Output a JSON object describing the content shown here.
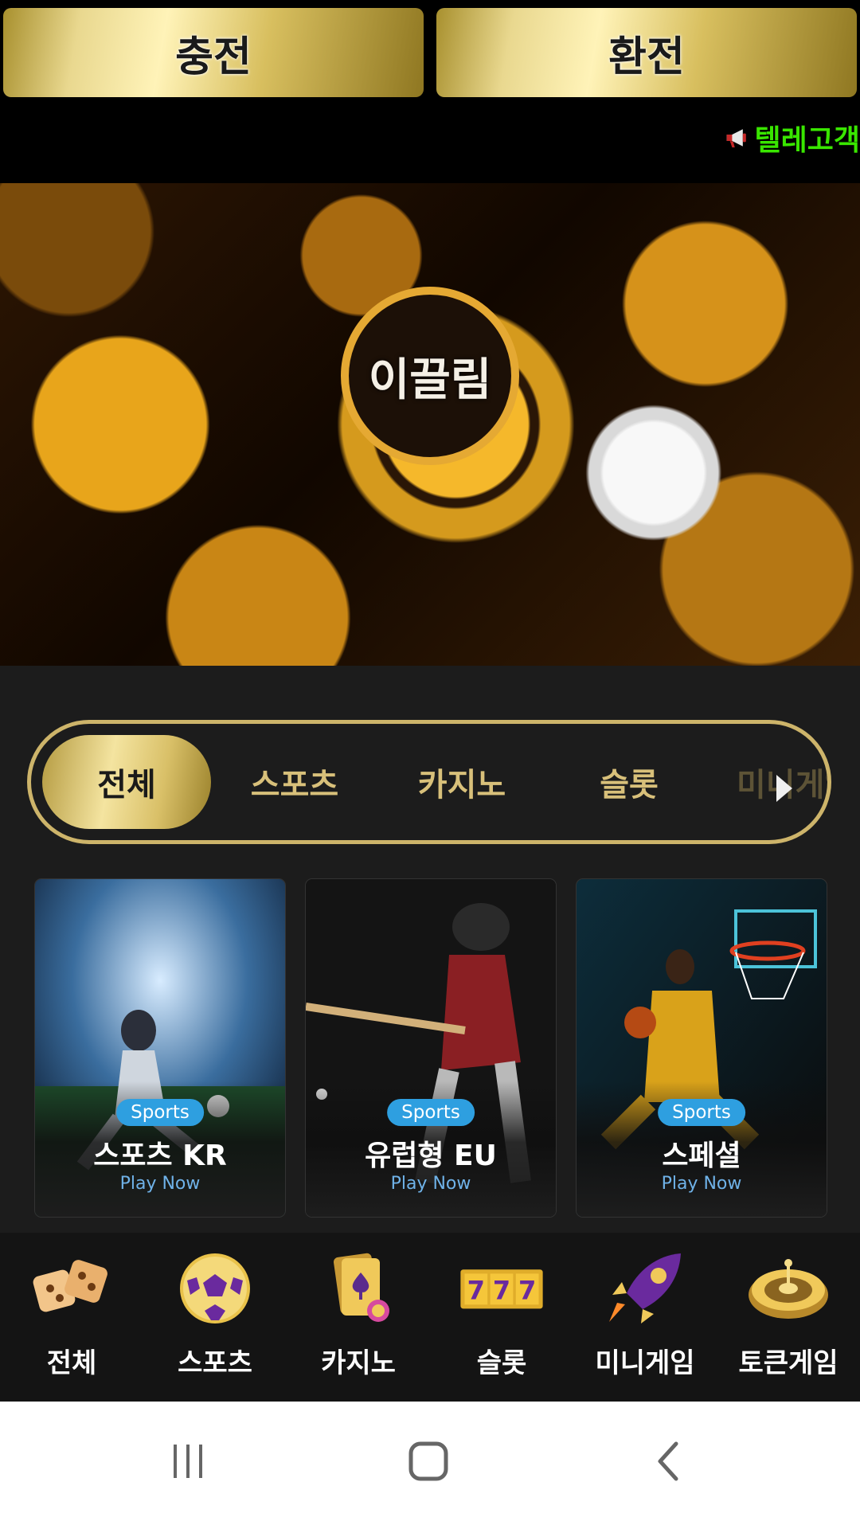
{
  "top_buttons": {
    "charge_label": "충전",
    "exchange_label": "환전"
  },
  "notice": {
    "text": "텔레고객",
    "icon": "megaphone-icon"
  },
  "banner": {
    "logo_text": "이끌림"
  },
  "category_tabs": {
    "items": [
      "전체",
      "스포츠",
      "카지노",
      "슬롯",
      "미니게임"
    ],
    "active": "전체"
  },
  "game_cards": [
    {
      "badge": "Sports",
      "title": "스포츠 KR",
      "cta": "Play Now"
    },
    {
      "badge": "Sports",
      "title": "유럽형 EU",
      "cta": "Play Now"
    },
    {
      "badge": "Sports",
      "title": "스페셜",
      "cta": "Play Now"
    }
  ],
  "bottom_nav": [
    {
      "label": "전체",
      "icon": "dice-icon"
    },
    {
      "label": "스포츠",
      "icon": "soccer-ball-icon"
    },
    {
      "label": "카지노",
      "icon": "playing-cards-icon"
    },
    {
      "label": "슬롯",
      "icon": "slot-777-icon"
    },
    {
      "label": "미니게임",
      "icon": "rocket-icon"
    },
    {
      "label": "토큰게임",
      "icon": "roulette-icon"
    }
  ],
  "colors": {
    "gold": "#d9c068",
    "notice_green": "#39e600",
    "badge_blue": "#2e9fe0"
  }
}
